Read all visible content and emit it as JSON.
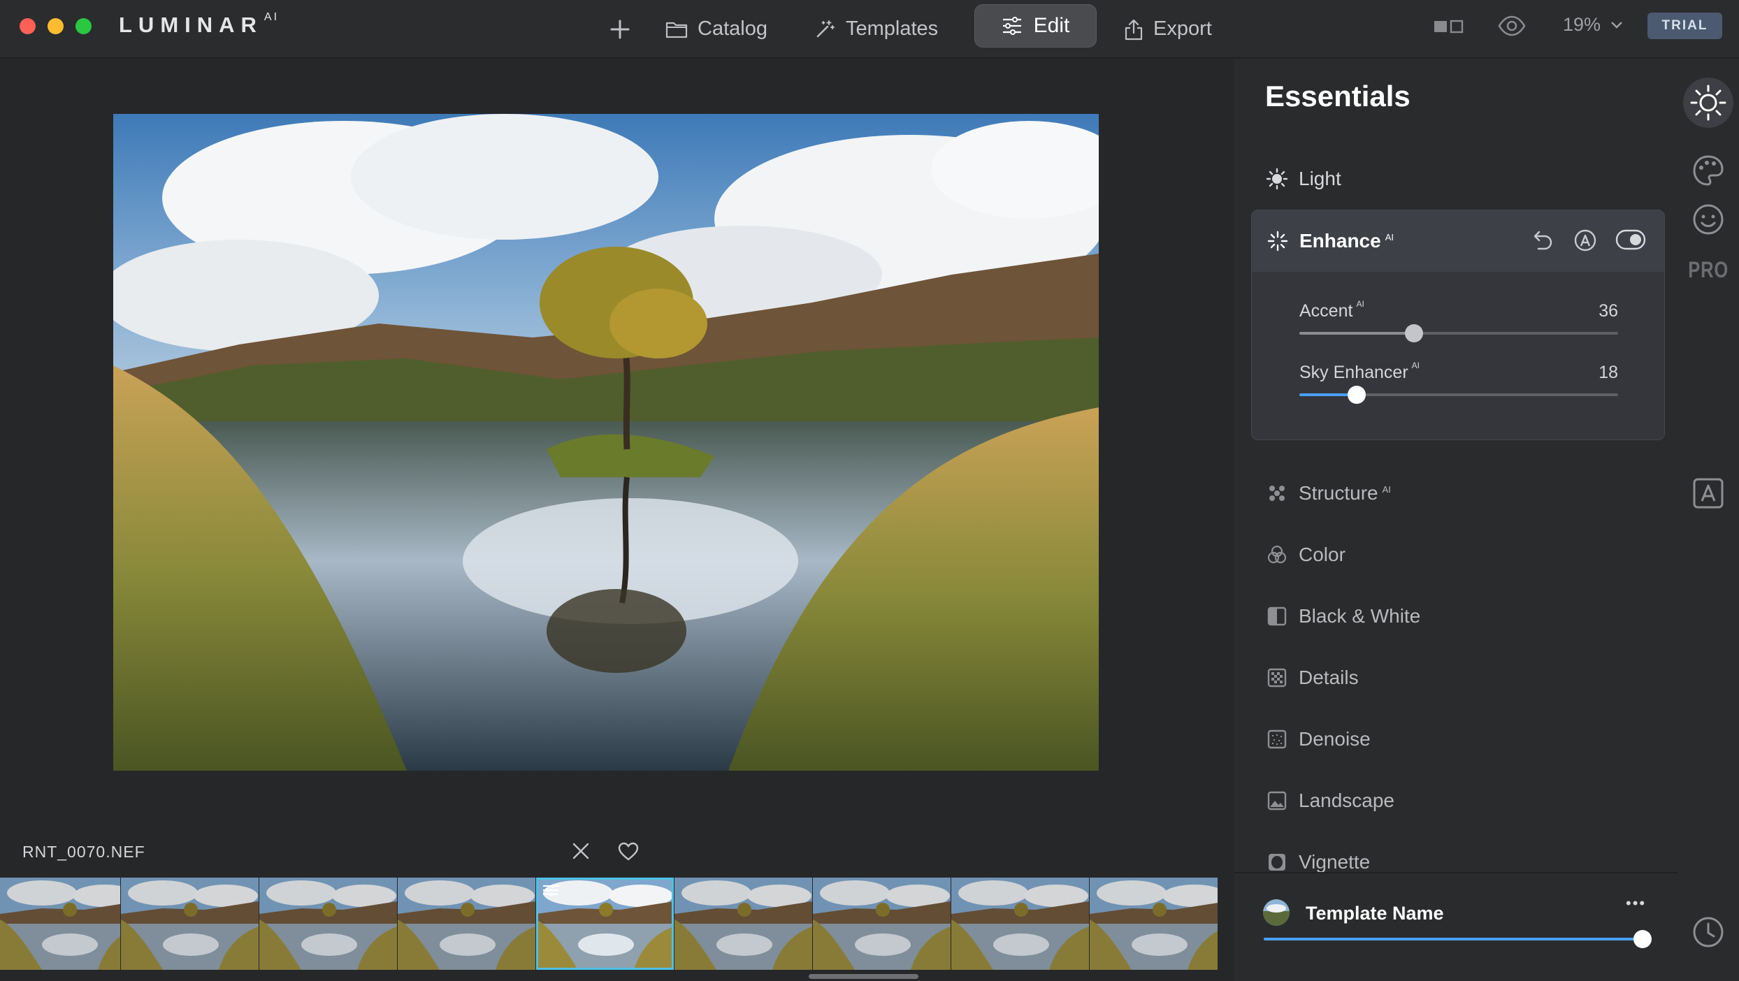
{
  "window": {
    "app_name": "LUMINAR",
    "app_name_suffix": "AI"
  },
  "nav": {
    "add_label": "",
    "catalog_label": "Catalog",
    "templates_label": "Templates",
    "edit_label": "Edit",
    "export_label": "Export",
    "zoom_value": "19%",
    "trial_label": "TRIAL"
  },
  "colors": {
    "accent_blue": "#4a9ff5",
    "selection_outline": "#4cc2e8",
    "traffic_red": "#fe5f57",
    "traffic_yellow": "#febc2e",
    "traffic_green": "#28c840"
  },
  "panel": {
    "title": "Essentials",
    "tools": [
      {
        "label": "Light",
        "icon": "sun-icon",
        "ai": ""
      },
      {
        "label": "Enhance",
        "icon": "sparkle-icon",
        "ai": "AI"
      },
      {
        "label": "Structure",
        "icon": "dots-icon",
        "ai": "AI"
      },
      {
        "label": "Color",
        "icon": "color-circles-icon",
        "ai": ""
      },
      {
        "label": "Black & White",
        "icon": "half-square-icon",
        "ai": ""
      },
      {
        "label": "Details",
        "icon": "grid-icon",
        "ai": ""
      },
      {
        "label": "Denoise",
        "icon": "noise-square-icon",
        "ai": ""
      },
      {
        "label": "Landscape",
        "icon": "mountain-icon",
        "ai": ""
      },
      {
        "label": "Vignette",
        "icon": "vignette-icon",
        "ai": ""
      }
    ],
    "enhance": {
      "sliders": [
        {
          "label": "Accent",
          "ai": "AI",
          "value": 36,
          "value_text": "36"
        },
        {
          "label": "Sky Enhancer",
          "ai": "AI",
          "value": 18,
          "value_text": "18"
        }
      ]
    }
  },
  "template": {
    "name": "Template Name",
    "more_label": "•••",
    "amount": 100
  },
  "rail": {
    "pro_label": "PRO"
  },
  "filmstrip": {
    "filename": "RNT_0070.NEF",
    "thumb_count": 9,
    "selected_index": 4
  }
}
